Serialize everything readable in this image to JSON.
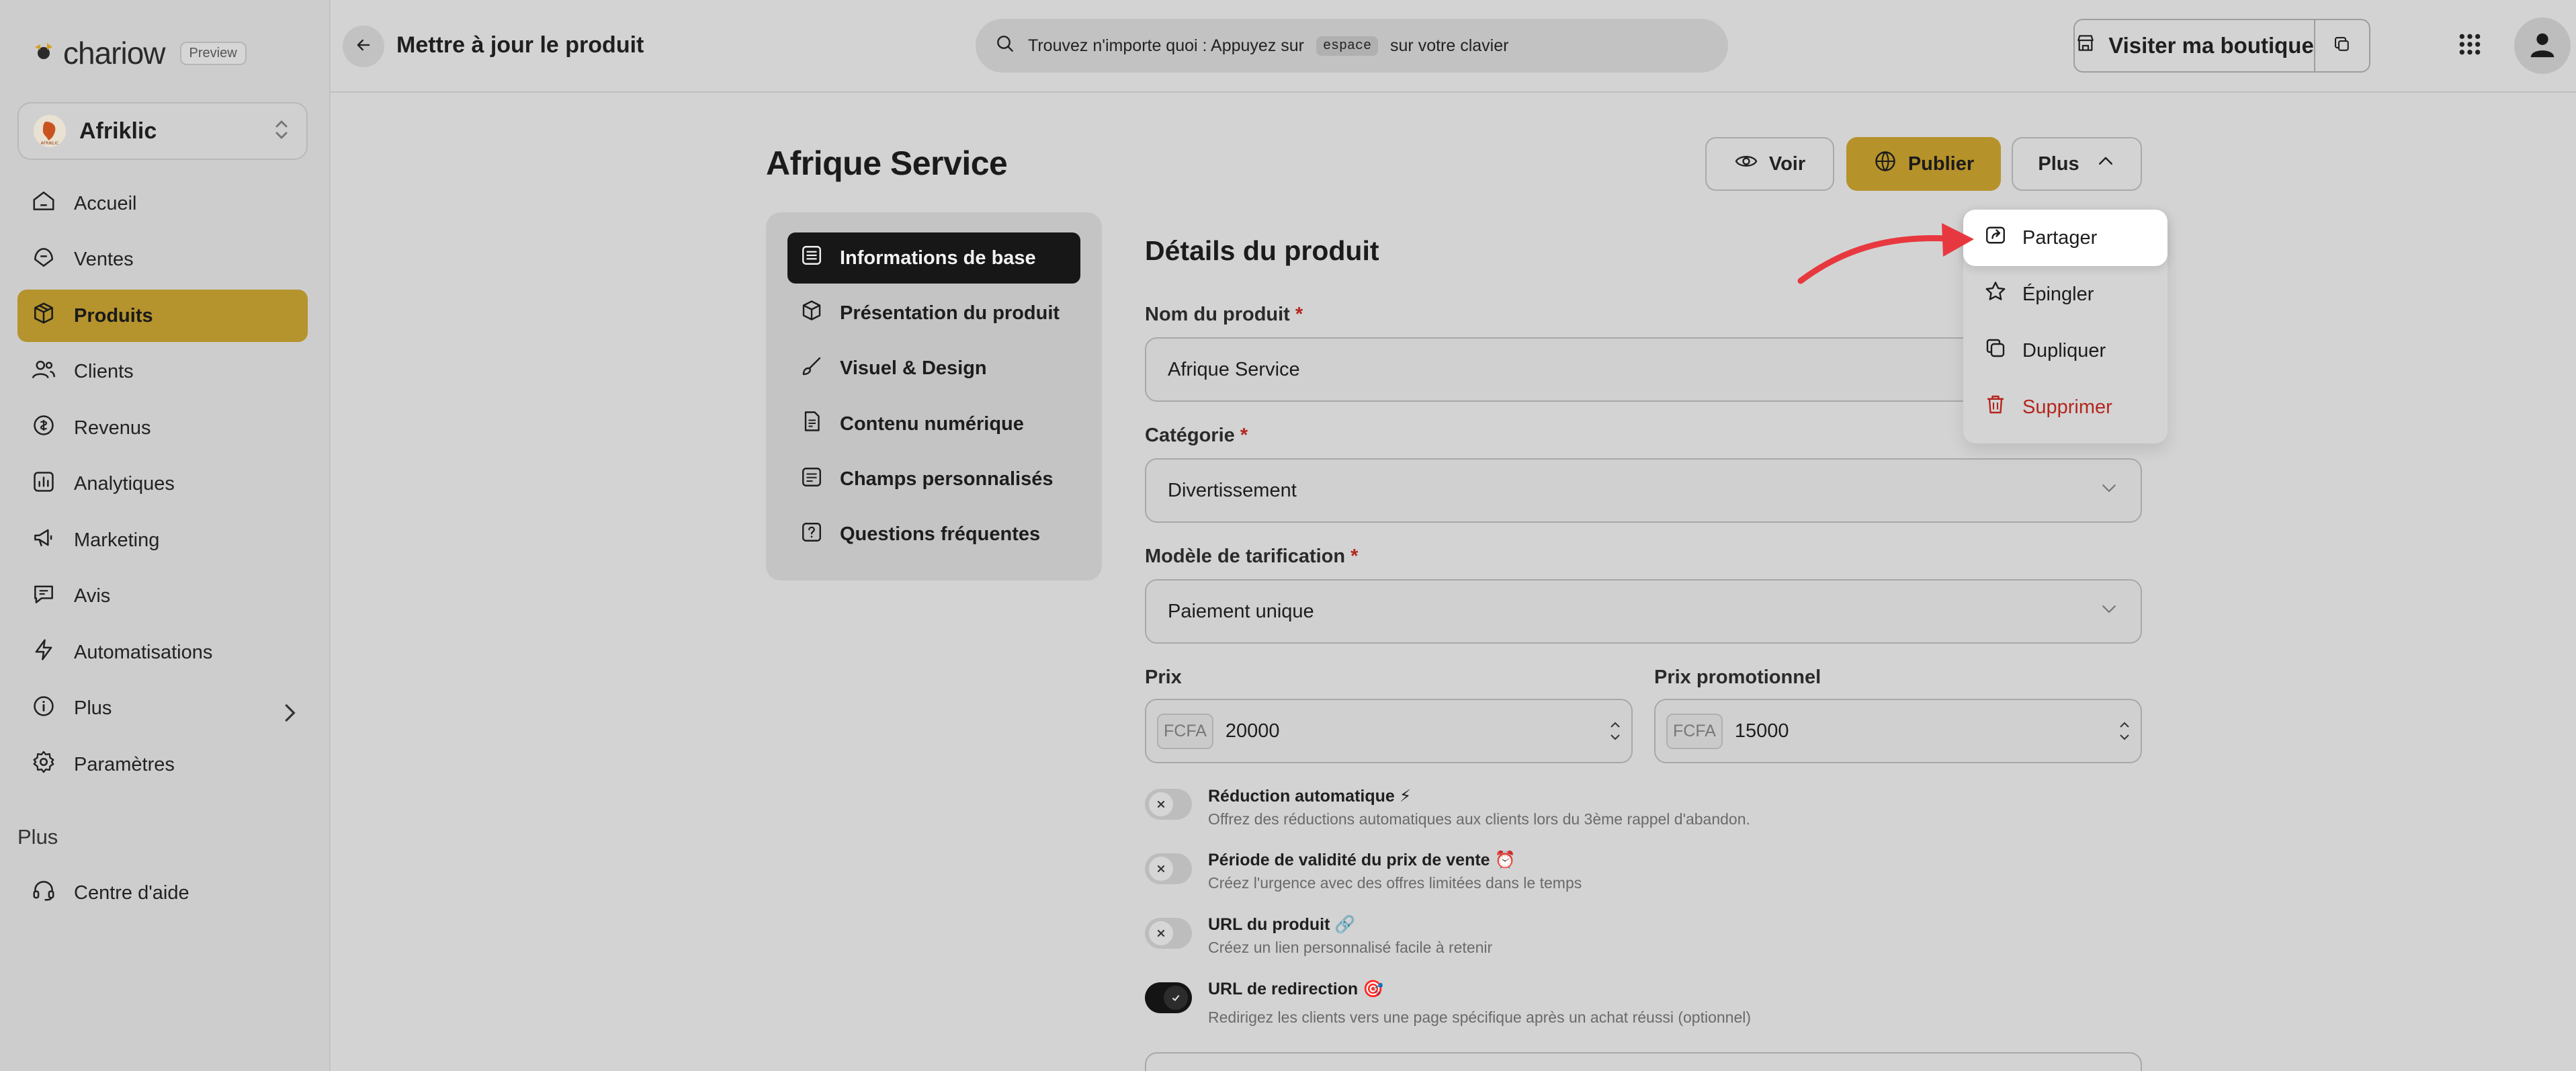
{
  "brand": {
    "name": "chariow",
    "badge": "Preview"
  },
  "store": {
    "name": "Afriklic",
    "avatar_text": "AFRIKLIC"
  },
  "sidebar": {
    "items": [
      {
        "label": "Accueil",
        "icon": "home-icon"
      },
      {
        "label": "Ventes",
        "icon": "sales-icon"
      },
      {
        "label": "Produits",
        "icon": "box-icon",
        "active": true
      },
      {
        "label": "Clients",
        "icon": "users-icon"
      },
      {
        "label": "Revenus",
        "icon": "coins-icon"
      },
      {
        "label": "Analytiques",
        "icon": "chart-icon"
      },
      {
        "label": "Marketing",
        "icon": "megaphone-icon"
      },
      {
        "label": "Avis",
        "icon": "message-icon"
      },
      {
        "label": "Automatisations",
        "icon": "bolt-icon"
      },
      {
        "label": "Plus",
        "icon": "info-icon"
      },
      {
        "label": "Paramètres",
        "icon": "gear-icon"
      }
    ],
    "section_label": "Plus",
    "help_label": "Centre d'aide"
  },
  "topbar": {
    "title": "Mettre à jour le produit",
    "search_prefix": "Trouvez n'importe quoi : Appuyez sur",
    "search_key": "espace",
    "search_suffix": "sur votre clavier",
    "visit_label": "Visiter ma boutique"
  },
  "product": {
    "title": "Afrique Service",
    "actions": {
      "view": "Voir",
      "publish": "Publier",
      "more": "Plus"
    }
  },
  "tabs": [
    {
      "label": "Informations de base",
      "icon": "list-icon",
      "active": true
    },
    {
      "label": "Présentation du produit",
      "icon": "box-icon"
    },
    {
      "label": "Visuel & Design",
      "icon": "brush-icon"
    },
    {
      "label": "Contenu numérique",
      "icon": "file-icon"
    },
    {
      "label": "Champs personnalisés",
      "icon": "form-icon"
    },
    {
      "label": "Questions fréquentes",
      "icon": "question-icon"
    }
  ],
  "form": {
    "section_title": "Détails du produit",
    "name_label": "Nom du produit",
    "name_value": "Afrique Service",
    "category_label": "Catégorie",
    "category_value": "Divertissement",
    "pricing_label": "Modèle de tarification",
    "pricing_value": "Paiement unique",
    "price_label": "Prix",
    "price_currency": "FCFA",
    "price_value": "20000",
    "promo_label": "Prix promotionnel",
    "promo_currency": "FCFA",
    "promo_value": "15000",
    "required_mark": "*"
  },
  "toggles": [
    {
      "title": "Réduction automatique ⚡",
      "desc": "Offrez des réductions automatiques aux clients lors du 3ème rappel d'abandon.",
      "on": false
    },
    {
      "title": "Période de validité du prix de vente ⏰",
      "desc": "Créez l'urgence avec des offres limitées dans le temps",
      "on": false
    },
    {
      "title": "URL du produit 🔗",
      "desc": "Créez un lien personnalisé facile à retenir",
      "on": false
    },
    {
      "title": "URL de redirection 🎯",
      "desc": "Redirigez les clients vers une page spécifique après un achat réussi (optionnel)",
      "on": true
    }
  ],
  "dropdown": {
    "items": [
      {
        "label": "Partager",
        "icon": "share-icon"
      },
      {
        "label": "Épingler",
        "icon": "star-icon"
      },
      {
        "label": "Dupliquer",
        "icon": "copy-icon"
      },
      {
        "label": "Supprimer",
        "icon": "trash-icon",
        "danger": true
      }
    ]
  },
  "colors": {
    "accent": "#b6922a",
    "danger": "#b3261e",
    "arrow": "#e8383f"
  }
}
